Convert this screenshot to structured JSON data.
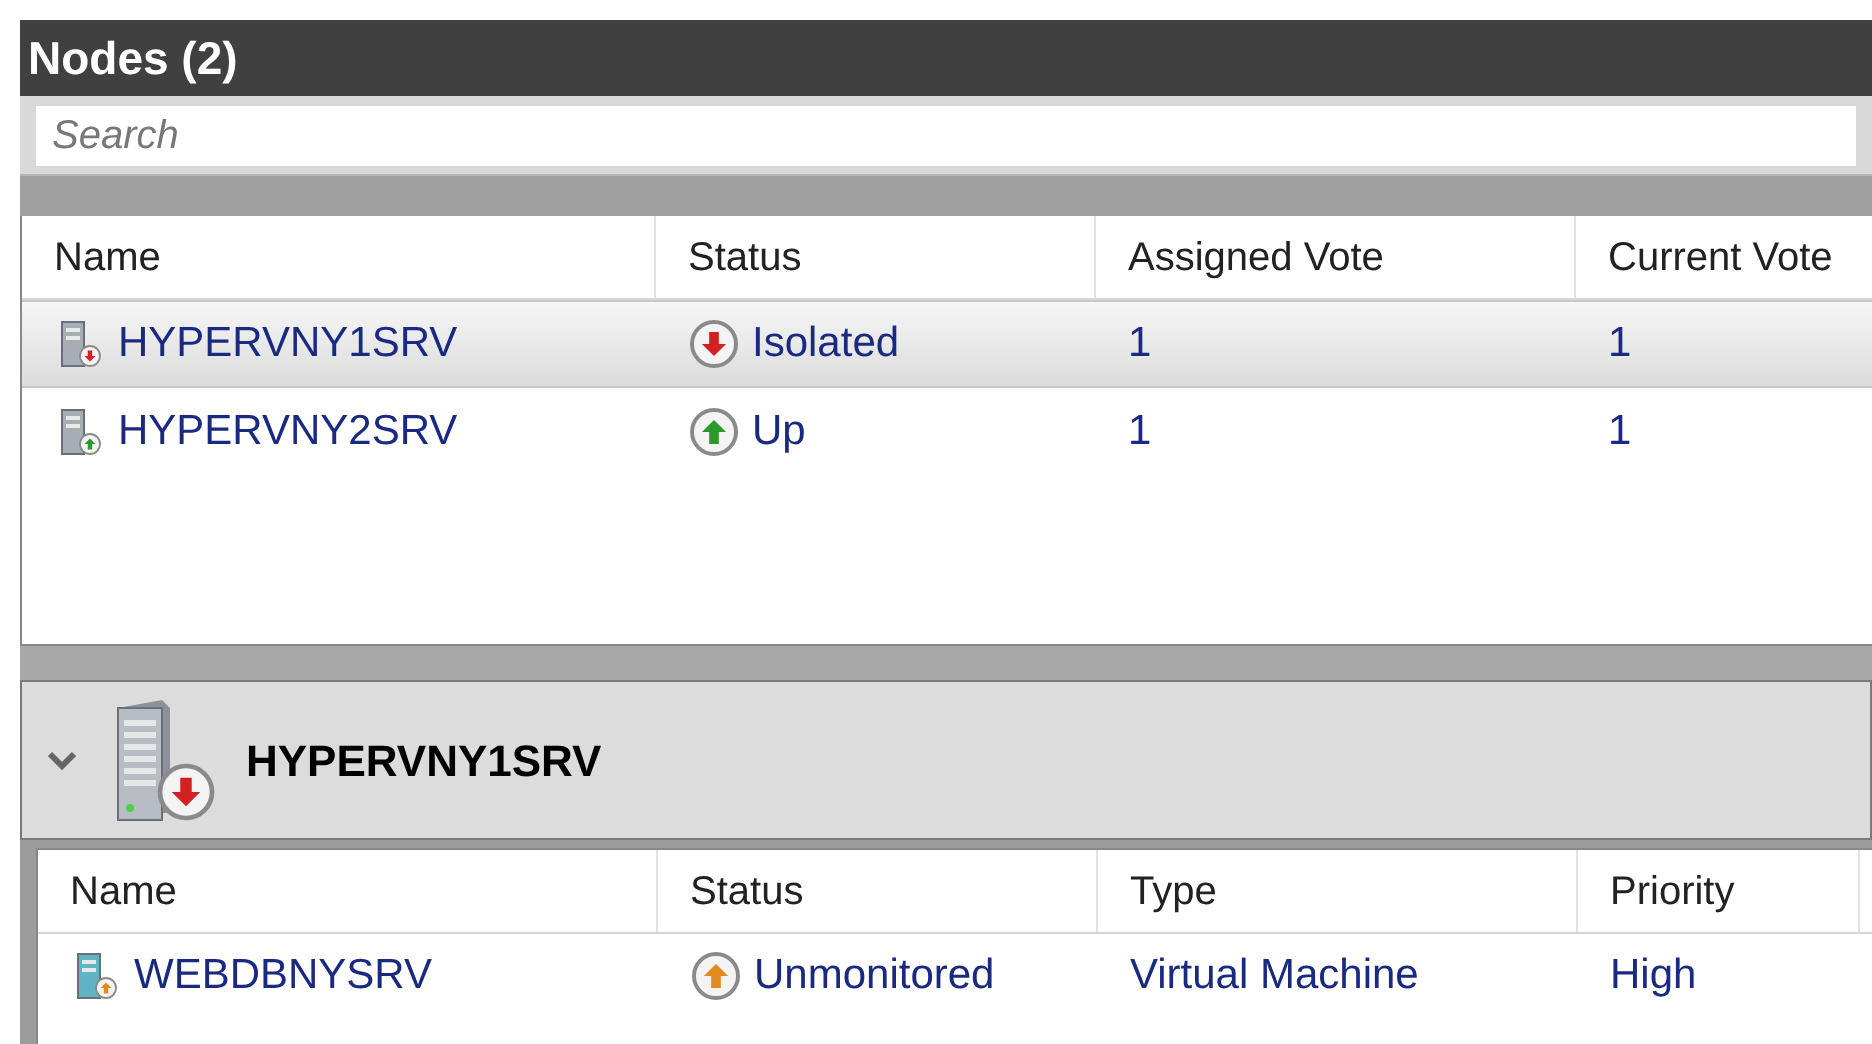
{
  "panel": {
    "title": "Nodes (2)"
  },
  "search": {
    "placeholder": "Search"
  },
  "nodes_table": {
    "columns": [
      "Name",
      "Status",
      "Assigned Vote",
      "Current Vote"
    ],
    "rows": [
      {
        "name": "HYPERVNY1SRV",
        "status": "Isolated",
        "kind": "down",
        "assigned_vote": "1",
        "current_vote": "1",
        "selected": true
      },
      {
        "name": "HYPERVNY2SRV",
        "status": "Up",
        "kind": "up",
        "assigned_vote": "1",
        "current_vote": "1",
        "selected": false
      }
    ]
  },
  "detail": {
    "expanded": true,
    "title": "HYPERVNY1SRV",
    "kind": "down",
    "table": {
      "columns": [
        "Name",
        "Status",
        "Type",
        "Priority"
      ],
      "rows": [
        {
          "name": "WEBDBNYSRV",
          "status": "Unmonitored",
          "kind": "warning",
          "type": "Virtual Machine",
          "priority": "High"
        }
      ]
    }
  }
}
